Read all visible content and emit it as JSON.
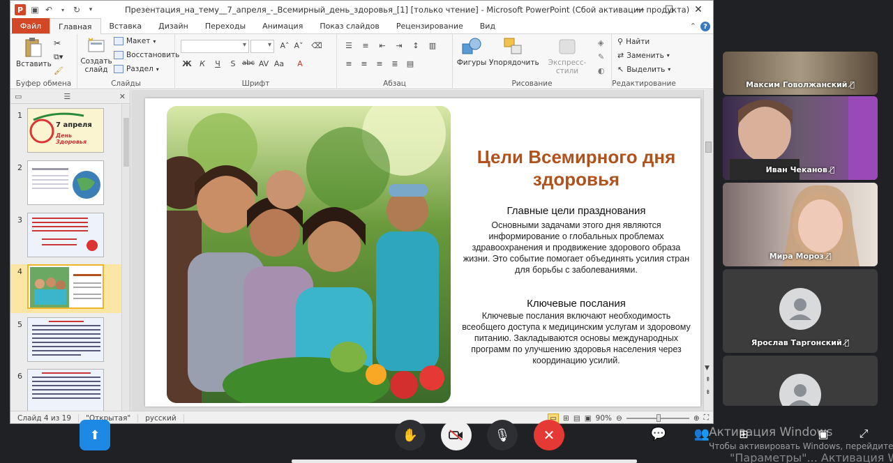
{
  "window": {
    "title": "Презентация_на_тему__7_апреля_-_Всемирный_день_здоровья_[1] [только чтение]  -  Microsoft PowerPoint (Сбой активации продукта)"
  },
  "tabs": [
    "Файл",
    "Главная",
    "Вставка",
    "Дизайн",
    "Переходы",
    "Анимация",
    "Показ слайдов",
    "Рецензирование",
    "Вид"
  ],
  "ribbon": {
    "paste": "Вставить",
    "new_slide_1": "Создать",
    "new_slide_2": "слайд",
    "layout": "Макет",
    "reset": "Восстановить",
    "section": "Раздел",
    "shapes": "Фигуры",
    "arrange": "Упорядочить",
    "quick_styles": "Экспресс-стили",
    "find": "Найти",
    "replace": "Заменить",
    "select": "Выделить",
    "groups": {
      "clipboard": "Буфер обмена",
      "slides": "Слайды",
      "font": "Шрифт",
      "paragraph": "Абзац",
      "drawing": "Рисование",
      "editing": "Редактирование"
    }
  },
  "thumbnails": {
    "numbers": [
      "1",
      "2",
      "3",
      "4",
      "5",
      "6"
    ],
    "slide1_line1": "7 апреля",
    "slide1_line2": "День Здоровья"
  },
  "slide": {
    "title": "Цели Всемирного дня здоровья",
    "section1_heading": "Главные цели празднования",
    "section1_text": "Основными задачами этого дня являются информирование о глобальных проблемах здравоохранения и продвижение здорового образа жизни. Это событие помогает объединять усилия стран для борьбы с заболеваниями.",
    "section2_heading": "Ключевые послания",
    "section2_text": "Ключевые послания включают необходимость всеобщего доступа к медицинским услугам и здоровому питанию. Закладываются основы международных программ по улучшению здоровья населения через координацию усилий."
  },
  "statusbar": {
    "slide_counter": "Слайд 4 из 19",
    "theme": "\"Открытая\"",
    "language": "русский",
    "zoom": "90%"
  },
  "participants": [
    {
      "name": "Максим Говолжанский"
    },
    {
      "name": "Иван Чеканов"
    },
    {
      "name": "Мира Мороз"
    },
    {
      "name": "Ярослав Таргонский"
    }
  ],
  "watermark": {
    "line1": "Активация Windows",
    "line2": "Чтобы активировать Windows, перейдите",
    "line3": "\"Параметры\"... Активация Windows"
  },
  "colors": {
    "accent": "#d24726",
    "title": "#b1521c",
    "end_call": "#e53935",
    "share": "#1e88e5"
  }
}
